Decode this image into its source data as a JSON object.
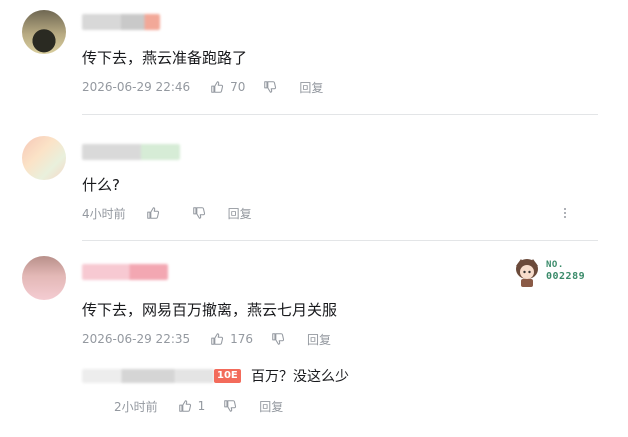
{
  "comments": [
    {
      "content": "传下去，燕云准备跑路了",
      "time": "2026-06-29 22:46",
      "likes": "70",
      "reply_label": "回复"
    },
    {
      "content": "什么?",
      "time": "4小时前",
      "likes": "",
      "reply_label": "回复"
    },
    {
      "content": "传下去，网易百万撤离，燕云七月关服",
      "time": "2026-06-29 22:35",
      "likes": "176",
      "reply_label": "回复",
      "badge": {
        "label": "NO.",
        "number": "002289"
      }
    }
  ],
  "reply": {
    "level_tag": "10E",
    "content": "百万？没这么少",
    "time": "2小时前",
    "likes": "1",
    "reply_label": "回复"
  },
  "icons": {
    "like": "thumbs-up-icon",
    "dislike": "thumbs-down-icon",
    "more": "more-vertical-icon"
  },
  "colors": {
    "text": "#18191c",
    "meta": "#9499a0",
    "divider": "#e3e5e7",
    "badge_green": "#3a8b6a"
  }
}
